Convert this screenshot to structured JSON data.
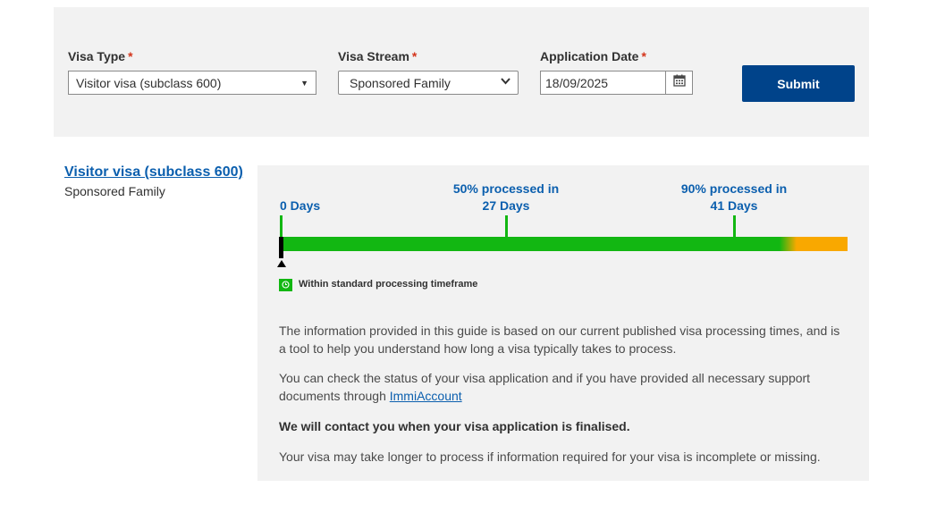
{
  "form": {
    "visa_type_label": "Visa Type",
    "visa_stream_label": "Visa Stream",
    "application_date_label": "Application Date",
    "required_mark": "*",
    "visa_type_value": "Visitor visa (subclass 600)",
    "visa_stream_value": "Sponsored Family",
    "application_date_value": "18/09/2025",
    "submit_label": "Submit"
  },
  "result": {
    "visa_title": "Visitor visa (subclass 600)",
    "visa_stream": "Sponsored Family",
    "timeline": {
      "start_label": "0 Days",
      "m50_line1": "50% processed in",
      "m50_line2": "27 Days",
      "m90_line1": "90% processed in",
      "m90_line2": "41 Days"
    },
    "legend": "Within standard processing timeframe",
    "para1": "The information provided in this guide is based on our current published visa processing times, and is a tool to help you understand how long a visa typically takes to process.",
    "para2_prefix": "You can check the status of your visa application and if you have provided all necessary support documents through ",
    "para2_link": "ImmiAccount",
    "para3": "We will contact you when your visa application is finalised.",
    "para4": "Your visa may take longer to process if information required for your visa is incomplete or missing."
  },
  "colors": {
    "accent": "#00438a",
    "link": "#0b5fae",
    "within_timeframe": "#12b712",
    "over_timeframe": "#f9a800",
    "required": "#d4351c"
  },
  "icons": {
    "date_picker": "calendar-icon",
    "legend": "clock-icon",
    "dropdown": "caret-down-icon"
  }
}
